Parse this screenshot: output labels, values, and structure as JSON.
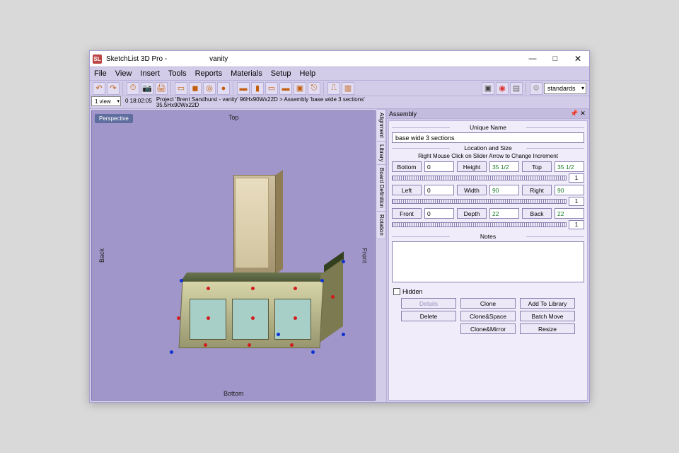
{
  "titlebar": {
    "app": "SketchList 3D Pro -",
    "doc": "vanity",
    "min": "—",
    "max": "□",
    "close": "✕"
  },
  "menu": [
    "File",
    "View",
    "Insert",
    "Tools",
    "Reports",
    "Materials",
    "Setup",
    "Help"
  ],
  "status": {
    "view_combo": "1 view",
    "timer": "0 18:02:05",
    "breadcrumb_line1": "Project 'Brent Sandhurst - vanity' 96Hx90Wx22D > Assembly 'base wide 3 sections'",
    "breadcrumb_line2": "35.5Hx90Wx22D"
  },
  "viewport": {
    "badge": "Perspective",
    "top": "Top",
    "bottom": "Bottom",
    "back": "Back",
    "front": "Front"
  },
  "side_tabs": [
    "Alignment",
    "Library",
    "Board Definition",
    "Rotation"
  ],
  "toolbar_right": {
    "combo": "standards"
  },
  "panel": {
    "title": "Assembly",
    "unique_name_label": "Unique Name",
    "unique_name_value": "base wide 3 sections",
    "loc_size_label": "Location and Size",
    "hint": "Right Mouse Click on Slider Arrow to Change Increment",
    "rows": [
      {
        "a_lbl": "Bottom",
        "a_val": "0",
        "b_lbl": "Height",
        "b_val": "35 1/2",
        "c_lbl": "Top",
        "c_val": "35 1/2"
      },
      {
        "a_lbl": "Left",
        "a_val": "0",
        "b_lbl": "Width",
        "b_val": "90",
        "c_lbl": "Right",
        "c_val": "90"
      },
      {
        "a_lbl": "Front",
        "a_val": "0",
        "b_lbl": "Depth",
        "b_val": "22",
        "c_lbl": "Back",
        "c_val": "22"
      }
    ],
    "step": "1",
    "notes_label": "Notes",
    "hidden_label": "Hidden",
    "buttons": {
      "details": "Details",
      "delete": "Delete",
      "clone": "Clone",
      "clone_space": "Clone&Space",
      "clone_mirror": "Clone&Mirror",
      "add_lib": "Add To Library",
      "batch_move": "Batch Move",
      "resize": "Resize"
    }
  }
}
